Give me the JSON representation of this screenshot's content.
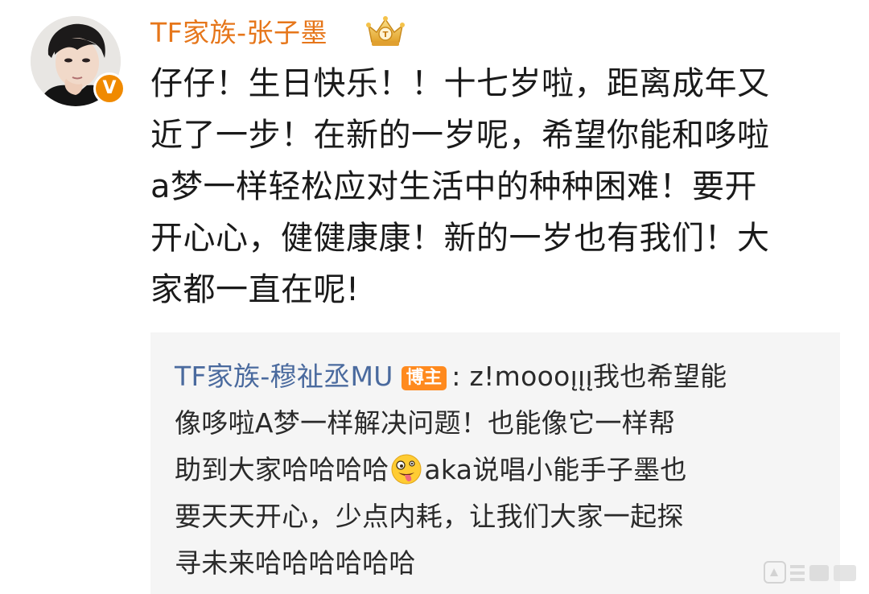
{
  "post": {
    "username": "TF家族-张子墨",
    "text_lines": [
      "仔仔！生日快乐！！十七岁啦，距离成年又",
      "近了一步！在新的一岁呢，希望你能和哆啦",
      "a梦一样轻松应对生活中的种种困难！要开",
      "开心心，健健康康！新的一岁也有我们！大",
      "家都一直在呢!"
    ],
    "verified_badge": "V",
    "icons": {
      "avatar": "avatar",
      "badge": "crown-fan-badge-icon"
    },
    "colors": {
      "username": "#e6761a",
      "verified": "#f08a00"
    }
  },
  "reply": {
    "username": "TF家族-穆祉丞MU",
    "author_badge": "博主",
    "line1_rest": ": z!moooı̨ı̨ı̨我也希望能",
    "line2": "像哆啦A梦一样解决问题！也能像它一样帮",
    "line3_before_emoji": "助到大家哈哈哈哈",
    "line3_after_emoji": "aka说唱小能手子墨也",
    "line4": "要天天开心，少点内耗，让我们大家一起探",
    "line5": "寻未来哈哈哈哈哈哈",
    "icons": {
      "emoji": "zany-face-emoji-icon"
    },
    "colors": {
      "username": "#4a6a9e",
      "badge": "#ff8a1e",
      "background": "#f5f5f5"
    }
  }
}
